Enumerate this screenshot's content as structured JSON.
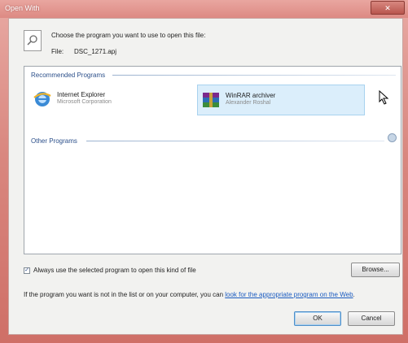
{
  "window": {
    "title": "Open With",
    "close_label": "✕"
  },
  "header": {
    "prompt": "Choose the program you want to use to open this file:",
    "file_label": "File:",
    "file_name": "DSC_1271.apj",
    "file_icon": "generic-file-icon"
  },
  "groups": {
    "recommended": "Recommended Programs",
    "other": "Other Programs"
  },
  "programs": [
    {
      "name": "Internet Explorer",
      "publisher": "Microsoft Corporation",
      "icon": "internet-explorer-icon",
      "selected": false
    },
    {
      "name": "WinRAR archiver",
      "publisher": "Alexander Roshal",
      "icon": "winrar-icon",
      "selected": true
    }
  ],
  "footer": {
    "always_use_label": "Always use the selected program to open this kind of file",
    "always_use_checked": true,
    "browse_label": "Browse...",
    "info_text": "If the program you want is not in the list or on your computer, you can ",
    "info_link": "look for the appropriate program on the Web",
    "info_end": ".",
    "ok_label": "OK",
    "cancel_label": "Cancel"
  },
  "colors": {
    "frame": "#d9877f",
    "selection": "#dbeefb",
    "link": "#1a5bc0",
    "group_header": "#2b4f8a"
  }
}
